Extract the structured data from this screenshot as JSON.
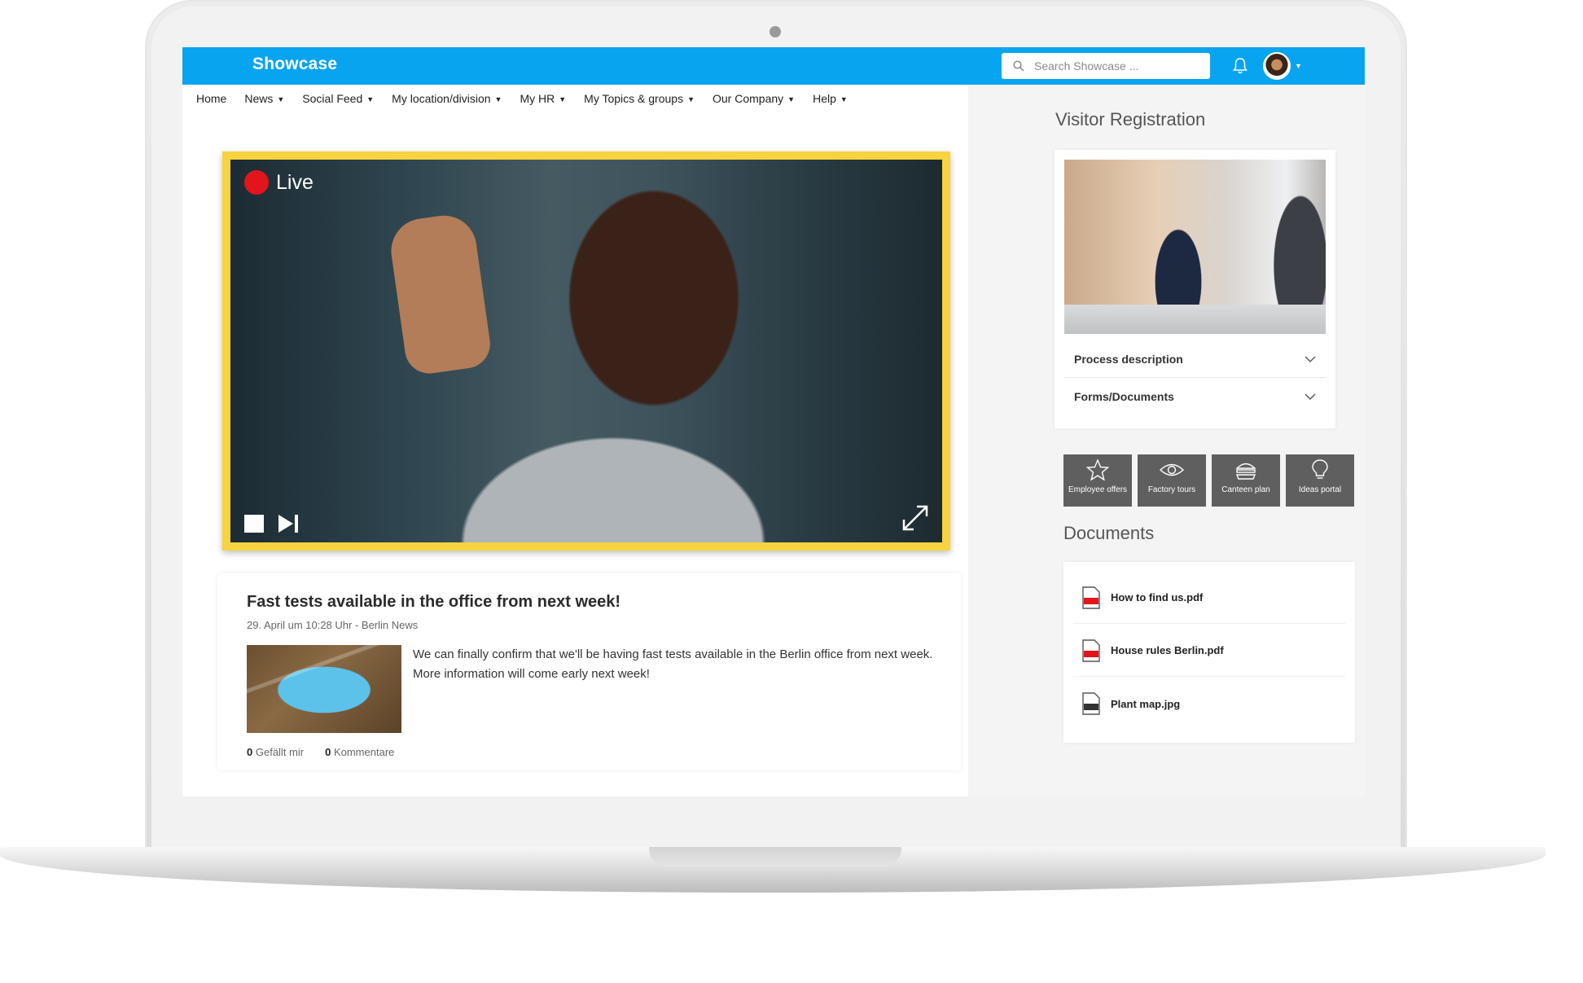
{
  "app": {
    "brand": "Showcase"
  },
  "search": {
    "placeholder": "Search Showcase ..."
  },
  "nav": {
    "items": [
      {
        "label": "Home",
        "has_dropdown": false
      },
      {
        "label": "News",
        "has_dropdown": true
      },
      {
        "label": "Social Feed",
        "has_dropdown": true
      },
      {
        "label": "My location/division",
        "has_dropdown": true
      },
      {
        "label": "My HR",
        "has_dropdown": true
      },
      {
        "label": "My Topics & groups",
        "has_dropdown": true
      },
      {
        "label": "Our Company",
        "has_dropdown": true
      },
      {
        "label": "Help",
        "has_dropdown": true
      }
    ],
    "caret": "▼"
  },
  "video": {
    "live_label": "Live",
    "frame_color": "#f6d33f",
    "live_color": "#e3141b"
  },
  "news": {
    "title": "Fast tests available in the office from next week!",
    "meta": "29. April um 10:28 Uhr - Berlin News",
    "body": "We can finally confirm that we'll be having fast tests available in the Berlin office from next week. More information will come early next week!",
    "likes_count": "0",
    "likes_label": "Gefällt mir",
    "comments_count": "0",
    "comments_label": "Kommentare"
  },
  "sidebar": {
    "visitor_title": "Visitor Registration",
    "accordion": [
      {
        "label": "Process description"
      },
      {
        "label": "Forms/Documents"
      }
    ],
    "tiles": [
      {
        "label": "Employee offers",
        "icon": "star-icon"
      },
      {
        "label": "Factory tours",
        "icon": "eye-icon"
      },
      {
        "label": "Canteen plan",
        "icon": "burger-icon"
      },
      {
        "label": "Ideas portal",
        "icon": "lightbulb-icon"
      }
    ],
    "documents_title": "Documents",
    "documents": [
      {
        "name": "How to find us.pdf",
        "type": "PDF"
      },
      {
        "name": "House rules Berlin.pdf",
        "type": "PDF"
      },
      {
        "name": "Plant map.jpg",
        "type": "JPG"
      }
    ]
  },
  "colors": {
    "topbar": "#08a4f0",
    "tile": "#5f5f5f",
    "pdf": "#e3141b"
  }
}
